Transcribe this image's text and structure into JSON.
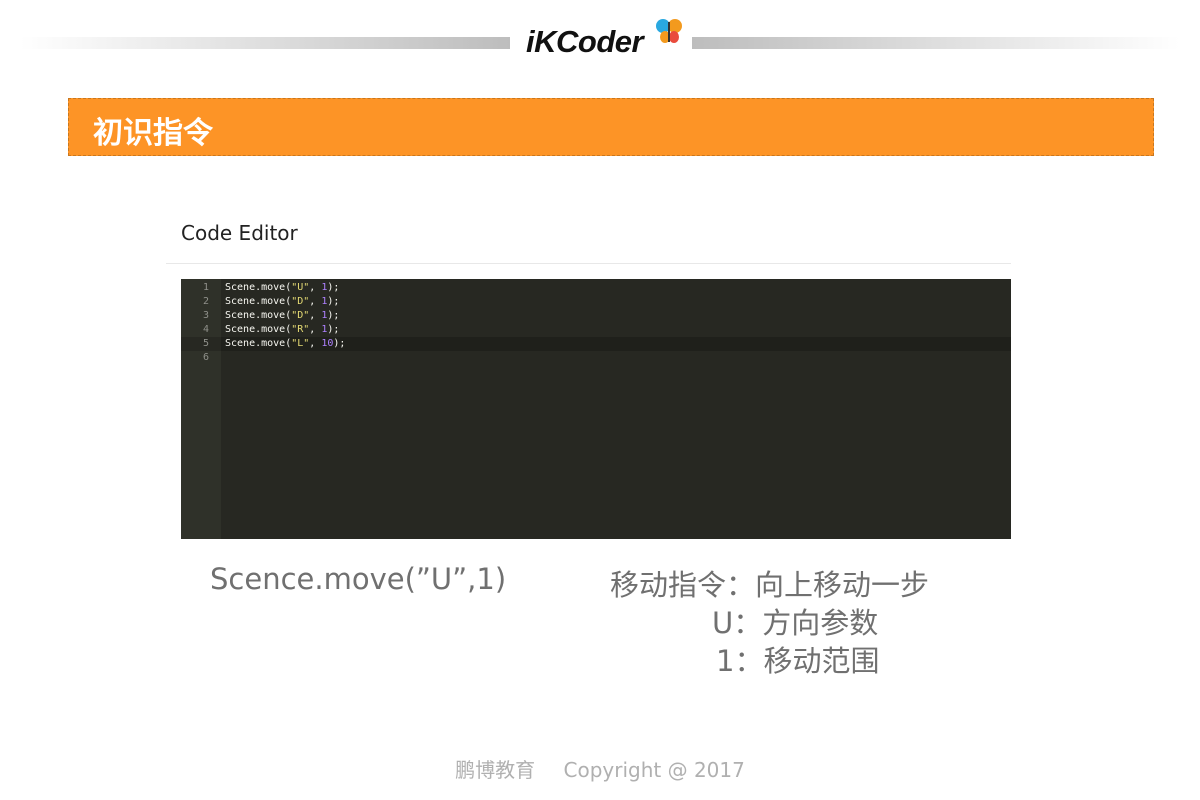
{
  "header": {
    "logo_text": "iKCoder",
    "colors": {
      "logo_blue": "#29a8e0",
      "logo_orange": "#f39a1e",
      "logo_red": "#e94b3c"
    }
  },
  "title_bar": {
    "title": "初识指令",
    "color": "#fd9426"
  },
  "editor": {
    "heading": "Code Editor",
    "active_line": 5,
    "lines": [
      {
        "num": "1",
        "prefix": "Scene.move(",
        "str": "\"U\"",
        "sep": ", ",
        "num_arg": "1",
        "suffix": ");"
      },
      {
        "num": "2",
        "prefix": "Scene.move(",
        "str": "\"D\"",
        "sep": ", ",
        "num_arg": "1",
        "suffix": ");"
      },
      {
        "num": "3",
        "prefix": "Scene.move(",
        "str": "\"D\"",
        "sep": ", ",
        "num_arg": "1",
        "suffix": ");"
      },
      {
        "num": "4",
        "prefix": "Scene.move(",
        "str": "\"R\"",
        "sep": ", ",
        "num_arg": "1",
        "suffix": ");"
      },
      {
        "num": "5",
        "prefix": "Scene.move(",
        "str": "\"L\"",
        "sep": ", ",
        "num_arg": "10",
        "suffix": ");"
      },
      {
        "num": "6",
        "prefix": "",
        "str": "",
        "sep": "",
        "num_arg": "",
        "suffix": ""
      }
    ],
    "colors": {
      "background": "#272822",
      "string": "#e6db74",
      "number": "#ae81ff",
      "text": "#f8f8f2"
    }
  },
  "explanation": {
    "code": "Scence.move(”U”,1)",
    "line1": "移动指令：向上移动一步",
    "line2": "U：方向参数",
    "line3": "1：移动范围"
  },
  "footer": {
    "org": "鹏博教育",
    "copyright": "Copyright @ 2017"
  }
}
